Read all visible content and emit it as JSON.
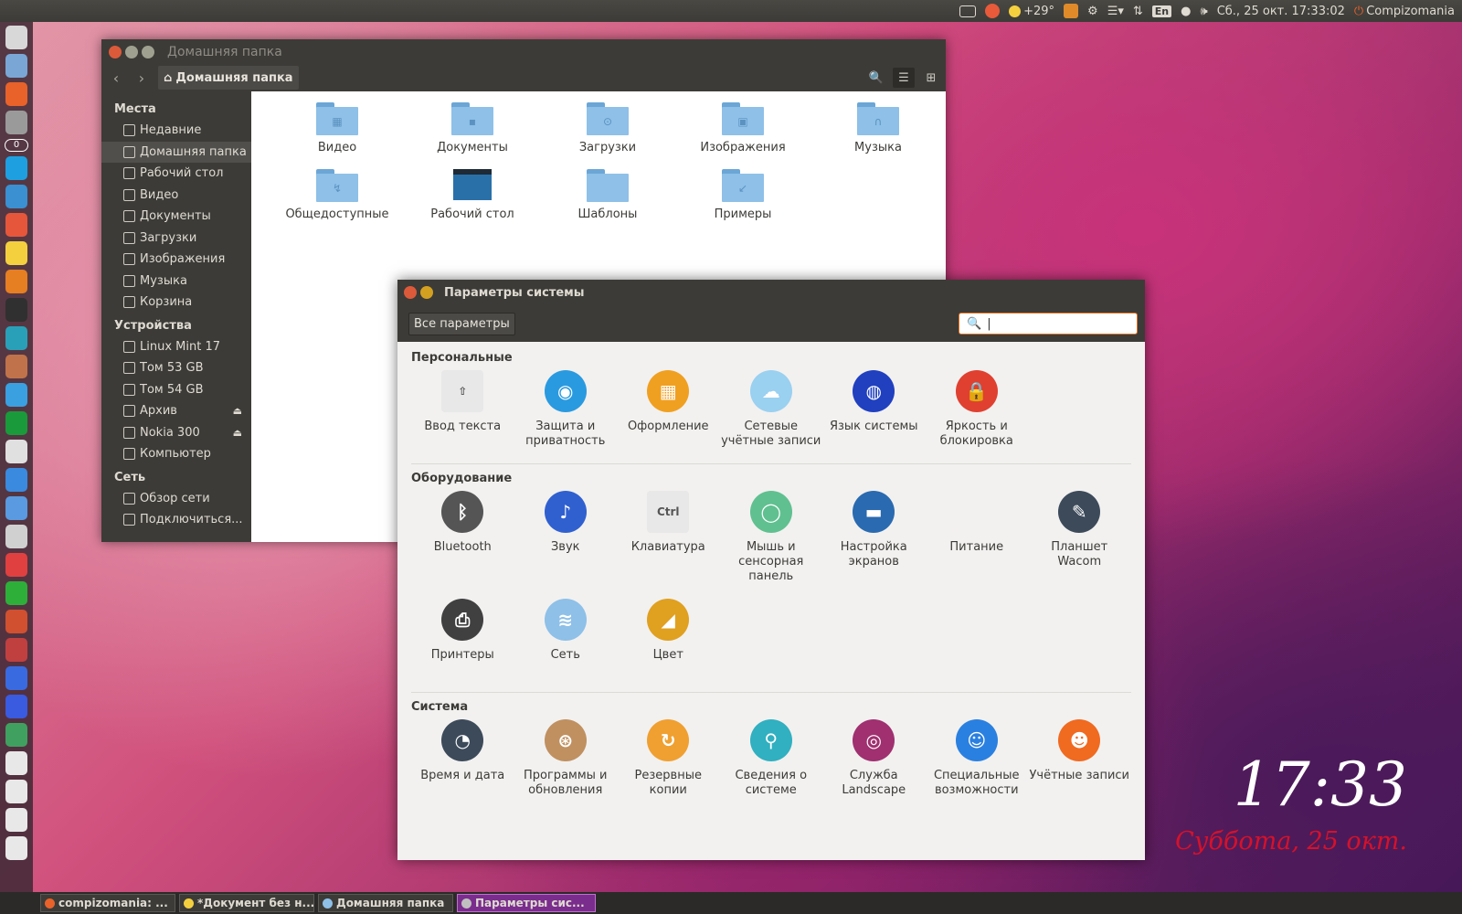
{
  "top_panel": {
    "temperature": "+29°",
    "language": "En",
    "datetime": "Сб., 25 окт. 17:33:02",
    "user": "Compizomania"
  },
  "launcher": {
    "badge": "0",
    "icon_colors": [
      "#d8d8d8",
      "#7aa6d6",
      "#e8622a",
      "#9a9a9a",
      "#ffffff",
      "#1ea0e0",
      "#3a90d0",
      "#e6563a",
      "#f4d03f",
      "#e67e22",
      "#303030",
      "#2aa0b8",
      "#c0734a",
      "#3aa0e0",
      "#1a9a3a",
      "#e0e0e0",
      "#3a8ae0",
      "#5a9ae0",
      "#d0d0d0",
      "#e04040",
      "#2eaf3a",
      "#d05030",
      "#c04040",
      "#3a6ae0",
      "#3a5ae0",
      "#40a060",
      "#e8e8e8",
      "#e8e8e8",
      "#e8e8e8",
      "#e8e8e8"
    ]
  },
  "taskbar": [
    {
      "label": "compizomania: ...",
      "dot": "#e8622a",
      "active": false
    },
    {
      "label": "*Документ без н...",
      "dot": "#f4d03f",
      "active": false
    },
    {
      "label": "Домашняя папка",
      "dot": "#8ec0e8",
      "active": false
    },
    {
      "label": "Параметры сис...",
      "dot": "#c0c0c0",
      "active": true
    }
  ],
  "clock_widget": {
    "time": "17:33",
    "date": "Суббота, 25 окт."
  },
  "file_manager": {
    "title": "Домашняя папка",
    "breadcrumb": "Домашняя папка",
    "sidebar": {
      "places_header": "Места",
      "places": [
        "Недавние",
        "Домашняя папка",
        "Рабочий стол",
        "Видео",
        "Документы",
        "Загрузки",
        "Изображения",
        "Музыка",
        "Корзина"
      ],
      "devices_header": "Устройства",
      "devices": [
        "Linux Mint 17",
        "Том 53 GB",
        "Том 54 GB",
        "Архив",
        "Nokia 300",
        "Компьютер"
      ],
      "network_header": "Сеть",
      "network": [
        "Обзор сети",
        "Подключиться..."
      ]
    },
    "items": [
      {
        "label": "Видео",
        "glyph": "▦",
        "type": "folder"
      },
      {
        "label": "Документы",
        "glyph": "▪",
        "type": "folder"
      },
      {
        "label": "Загрузки",
        "glyph": "⊙",
        "type": "folder"
      },
      {
        "label": "Изображения",
        "glyph": "▣",
        "type": "folder"
      },
      {
        "label": "Музыка",
        "glyph": "∩",
        "type": "folder"
      },
      {
        "label": "Общедоступные",
        "glyph": "↯",
        "type": "folder"
      },
      {
        "label": "Рабочий стол",
        "glyph": "",
        "type": "desktop"
      },
      {
        "label": "Шаблоны",
        "glyph": "",
        "type": "folder"
      },
      {
        "label": "Примеры",
        "glyph": "↙",
        "type": "folder"
      }
    ]
  },
  "settings": {
    "title": "Параметры системы",
    "all_button": "Все параметры",
    "search_value": "|",
    "sections": [
      {
        "title": "Персональные",
        "items": [
          {
            "label": "Ввод текста",
            "color": "#e8e8e8",
            "glyph": "⇧"
          },
          {
            "label": "Защита и приватность",
            "color": "#2a9ae0",
            "glyph": "◉"
          },
          {
            "label": "Оформление",
            "color": "#f0a020",
            "glyph": "▦"
          },
          {
            "label": "Сетевые учётные записи",
            "color": "#9ad0f0",
            "glyph": "☁"
          },
          {
            "label": "Язык системы",
            "color": "#2040c0",
            "glyph": "◍"
          },
          {
            "label": "Яркость и блокировка",
            "color": "#e04030",
            "glyph": "🔒"
          }
        ]
      },
      {
        "title": "Оборудование",
        "items": [
          {
            "label": "Bluetooth",
            "color": "#555555",
            "glyph": "ᛒ"
          },
          {
            "label": "Звук",
            "color": "#3060d0",
            "glyph": "♪"
          },
          {
            "label": "Клавиатура",
            "color": "#e8e8e8",
            "glyph": "Ctrl"
          },
          {
            "label": "Мышь и сенсорная панель",
            "color": "#60c090",
            "glyph": "◯"
          },
          {
            "label": "Настройка экранов",
            "color": "#2a6ab0",
            "glyph": "▬"
          },
          {
            "label": "Питание",
            "color": "#f2f1f0",
            "glyph": ""
          },
          {
            "label": "Планшет Wacom",
            "color": "#3c4a5a",
            "glyph": "✎"
          },
          {
            "label": "Принтеры",
            "color": "#404040",
            "glyph": "⎙"
          },
          {
            "label": "Сеть",
            "color": "#8ec0e8",
            "glyph": "≋"
          },
          {
            "label": "Цвет",
            "color": "#e0a020",
            "glyph": "◢"
          }
        ]
      },
      {
        "title": "Система",
        "items": [
          {
            "label": "Время и дата",
            "color": "#3c4a5a",
            "glyph": "◔"
          },
          {
            "label": "Программы и обновления",
            "color": "#c09060",
            "glyph": "⊛"
          },
          {
            "label": "Резервные копии",
            "color": "#f0a030",
            "glyph": "↻"
          },
          {
            "label": "Сведения о системе",
            "color": "#30b0c0",
            "glyph": "⚲"
          },
          {
            "label": "Служба Landscape",
            "color": "#a03070",
            "glyph": "◎"
          },
          {
            "label": "Специальные возможности",
            "color": "#2a80e0",
            "glyph": "☺"
          },
          {
            "label": "Учётные записи",
            "color": "#f06a20",
            "glyph": "☻"
          }
        ]
      }
    ]
  }
}
